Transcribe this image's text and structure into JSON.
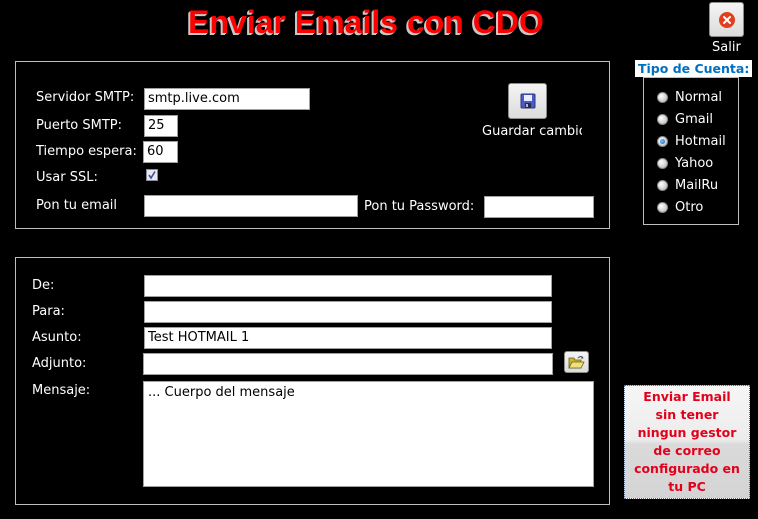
{
  "title": "Enviar Emails con CDO",
  "exit_button": {
    "label": "Salir",
    "icon": "close-icon"
  },
  "account_type": {
    "heading": "Tipo de Cuenta:",
    "options": [
      {
        "label": "Normal",
        "checked": false
      },
      {
        "label": "Gmail",
        "checked": false
      },
      {
        "label": "Hotmail",
        "checked": true
      },
      {
        "label": "Yahoo",
        "checked": false
      },
      {
        "label": "MailRu",
        "checked": false
      },
      {
        "label": "Otro",
        "checked": false
      }
    ]
  },
  "smtp": {
    "server_label": "Servidor SMTP:",
    "server_value": "smtp.live.com",
    "port_label": "Puerto SMTP:",
    "port_value": "25",
    "timeout_label": "Tiempo espera:",
    "timeout_value": "60",
    "ssl_label": "Usar SSL:",
    "ssl_checked": true,
    "email_label": "Pon tu email",
    "email_value": "",
    "password_label": "Pon tu Password:",
    "password_value": "",
    "save_label": "Guardar cambios",
    "save_icon": "floppy-disk-icon"
  },
  "message": {
    "from_label": "De:",
    "from_value": "",
    "to_label": "Para:",
    "to_value": "",
    "subject_label": "Asunto:",
    "subject_value": "Test HOTMAIL 1",
    "attachment_label": "Adjunto:",
    "attachment_value": "",
    "attachment_icon": "folder-open-icon",
    "body_label": "Mensaje:",
    "body_value": "... Cuerpo del mensaje"
  },
  "send_button": {
    "label": "Enviar Email sin tener ningun gestor de correo configurado en tu PC"
  },
  "colors": {
    "title": "#ff0000",
    "heading_blue": "#0070c0",
    "send_text": "#e3001b",
    "background": "#000000"
  }
}
